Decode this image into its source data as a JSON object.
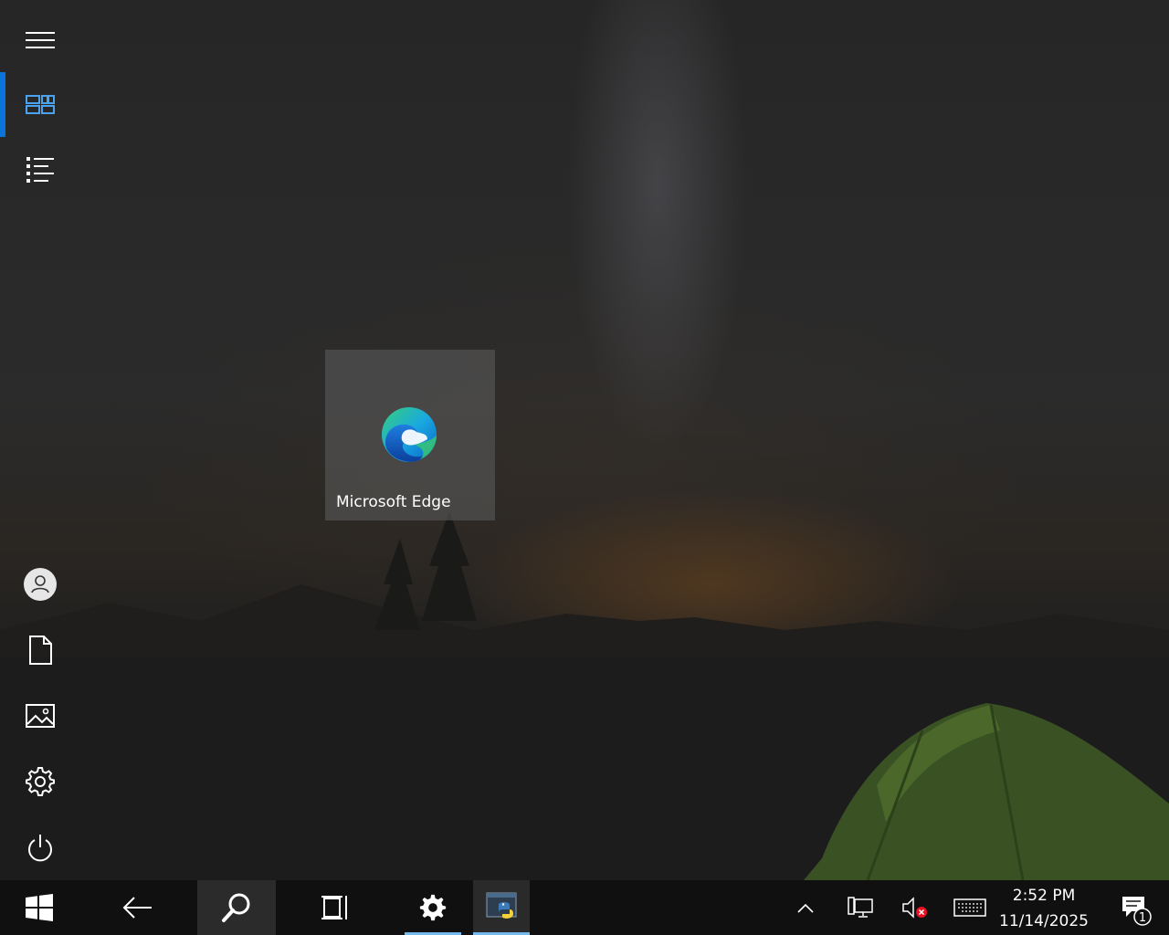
{
  "desktop": {
    "tiles": [
      {
        "label": "Microsoft Edge",
        "icon": "edge-logo-icon"
      }
    ]
  },
  "start_rail": {
    "top": [
      "hamburger-menu-icon",
      "tiles-view-icon",
      "all-apps-list-icon"
    ],
    "bottom": [
      "user-avatar-icon",
      "documents-icon",
      "pictures-icon",
      "settings-gear-icon",
      "power-icon"
    ],
    "active": "tiles-view-icon",
    "accent_color": "#0a74da"
  },
  "taskbar": {
    "buttons": [
      "windows-start-icon",
      "back-arrow-icon",
      "search-icon",
      "task-view-icon",
      "settings-app-icon",
      "python-app-icon"
    ],
    "tray": [
      "show-hidden-icons-chevron",
      "network-icon",
      "volume-muted-icon",
      "touch-keyboard-icon",
      "action-center-icon"
    ],
    "clock": {
      "time": "2:52 PM",
      "date": "11/14/2025"
    },
    "notifications_count": "1",
    "running_indicator_color": "#76b9ed"
  }
}
